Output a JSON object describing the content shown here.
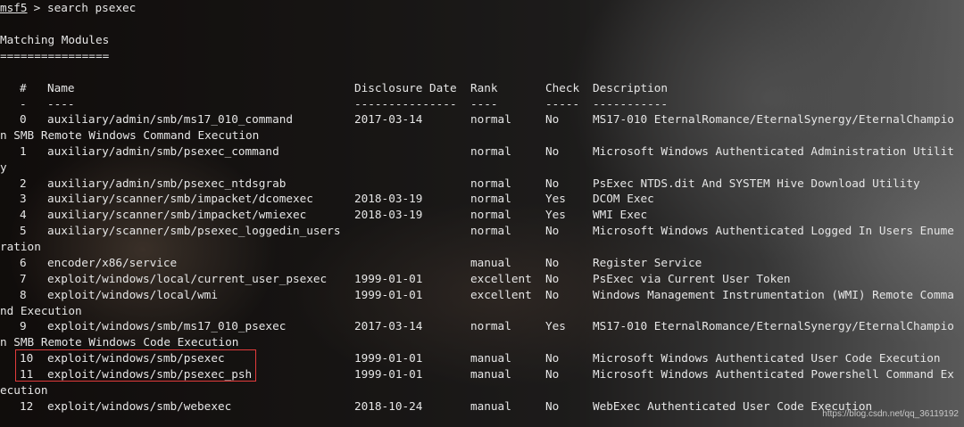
{
  "prompt": {
    "app": "msf5",
    "symbol": " > ",
    "command": "search psexec"
  },
  "section_title": "Matching Modules",
  "section_underline": "================",
  "table": {
    "headers": {
      "num": "#",
      "name": "Name",
      "date": "Disclosure Date",
      "rank": "Rank",
      "check": "Check",
      "description": "Description"
    },
    "separators": {
      "num": "-",
      "name": "----",
      "date": "---------------",
      "rank": "----",
      "check": "-----",
      "description": "-----------"
    },
    "rows": [
      {
        "num": "0",
        "name": "auxiliary/admin/smb/ms17_010_command",
        "date": "2017-03-14",
        "rank": "normal",
        "check": "No",
        "desc": "MS17-010 EternalRomance/EternalSynergy/EternalChampio",
        "wrap": "n SMB Remote Windows Command Execution"
      },
      {
        "num": "1",
        "name": "auxiliary/admin/smb/psexec_command",
        "date": "",
        "rank": "normal",
        "check": "No",
        "desc": "Microsoft Windows Authenticated Administration Utilit",
        "wrap": "y"
      },
      {
        "num": "2",
        "name": "auxiliary/admin/smb/psexec_ntdsgrab",
        "date": "",
        "rank": "normal",
        "check": "No",
        "desc": "PsExec NTDS.dit And SYSTEM Hive Download Utility",
        "wrap": ""
      },
      {
        "num": "3",
        "name": "auxiliary/scanner/smb/impacket/dcomexec",
        "date": "2018-03-19",
        "rank": "normal",
        "check": "Yes",
        "desc": "DCOM Exec",
        "wrap": ""
      },
      {
        "num": "4",
        "name": "auxiliary/scanner/smb/impacket/wmiexec",
        "date": "2018-03-19",
        "rank": "normal",
        "check": "Yes",
        "desc": "WMI Exec",
        "wrap": ""
      },
      {
        "num": "5",
        "name": "auxiliary/scanner/smb/psexec_loggedin_users",
        "date": "",
        "rank": "normal",
        "check": "No",
        "desc": "Microsoft Windows Authenticated Logged In Users Enume",
        "wrap": "ration"
      },
      {
        "num": "6",
        "name": "encoder/x86/service",
        "date": "",
        "rank": "manual",
        "check": "No",
        "desc": "Register Service",
        "wrap": ""
      },
      {
        "num": "7",
        "name": "exploit/windows/local/current_user_psexec",
        "date": "1999-01-01",
        "rank": "excellent",
        "check": "No",
        "desc": "PsExec via Current User Token",
        "wrap": ""
      },
      {
        "num": "8",
        "name": "exploit/windows/local/wmi",
        "date": "1999-01-01",
        "rank": "excellent",
        "check": "No",
        "desc": "Windows Management Instrumentation (WMI) Remote Comma",
        "wrap": "nd Execution"
      },
      {
        "num": "9",
        "name": "exploit/windows/smb/ms17_010_psexec",
        "date": "2017-03-14",
        "rank": "normal",
        "check": "Yes",
        "desc": "MS17-010 EternalRomance/EternalSynergy/EternalChampio",
        "wrap": "n SMB Remote Windows Code Execution"
      },
      {
        "num": "10",
        "name": "exploit/windows/smb/psexec",
        "date": "1999-01-01",
        "rank": "manual",
        "check": "No",
        "desc": "Microsoft Windows Authenticated User Code Execution",
        "wrap": ""
      },
      {
        "num": "11",
        "name": "exploit/windows/smb/psexec_psh",
        "date": "1999-01-01",
        "rank": "manual",
        "check": "No",
        "desc": "Microsoft Windows Authenticated Powershell Command Ex",
        "wrap": "ecution"
      },
      {
        "num": "12",
        "name": "exploit/windows/smb/webexec",
        "date": "2018-10-24",
        "rank": "manual",
        "check": "No",
        "desc": "WebExec Authenticated User Code Execution",
        "wrap": ""
      }
    ]
  },
  "highlighted_rows": [
    "10",
    "11"
  ],
  "highlight_color": "#e23b3b",
  "watermark": "https://blog.csdn.net/qq_36119192"
}
